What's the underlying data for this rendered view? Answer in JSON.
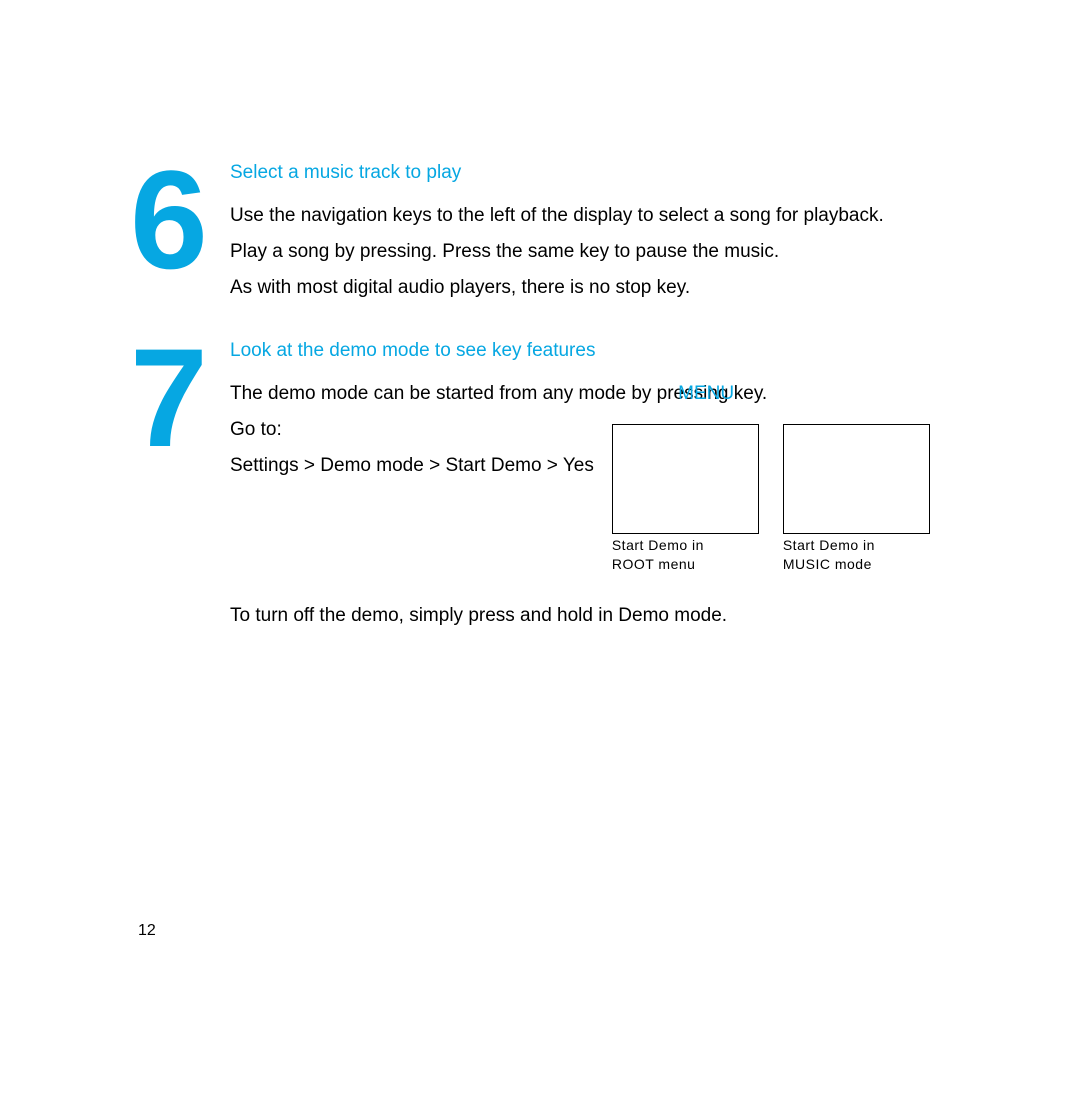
{
  "step6": {
    "number": "6",
    "title": "Select a music track to play",
    "line1": "Use the navigation keys to the left of the display to select a song for playback.",
    "line2": "Play a song by pressing. Press the same key to pause the music.",
    "line3": "As with most digital audio players, there is no stop key."
  },
  "step7": {
    "number": "7",
    "title": "Look at the demo mode to see key features",
    "line1_pre": "The demo mode can be started from any mode by pre",
    "line1_highlight": "MENU",
    "line1_overlap": "ssing",
    "line1_post": " key.",
    "goto": "Go to:",
    "path": "Settings > Demo mode > Start Demo > Yes",
    "screenshot1_caption_l1": "Start Demo in",
    "screenshot1_caption_l2": "ROOT menu",
    "screenshot2_caption_l1": "Start Demo in",
    "screenshot2_caption_l2": "MUSIC mode",
    "closing": "To turn off the demo, simply press and hold in Demo mode."
  },
  "page_number": "12"
}
